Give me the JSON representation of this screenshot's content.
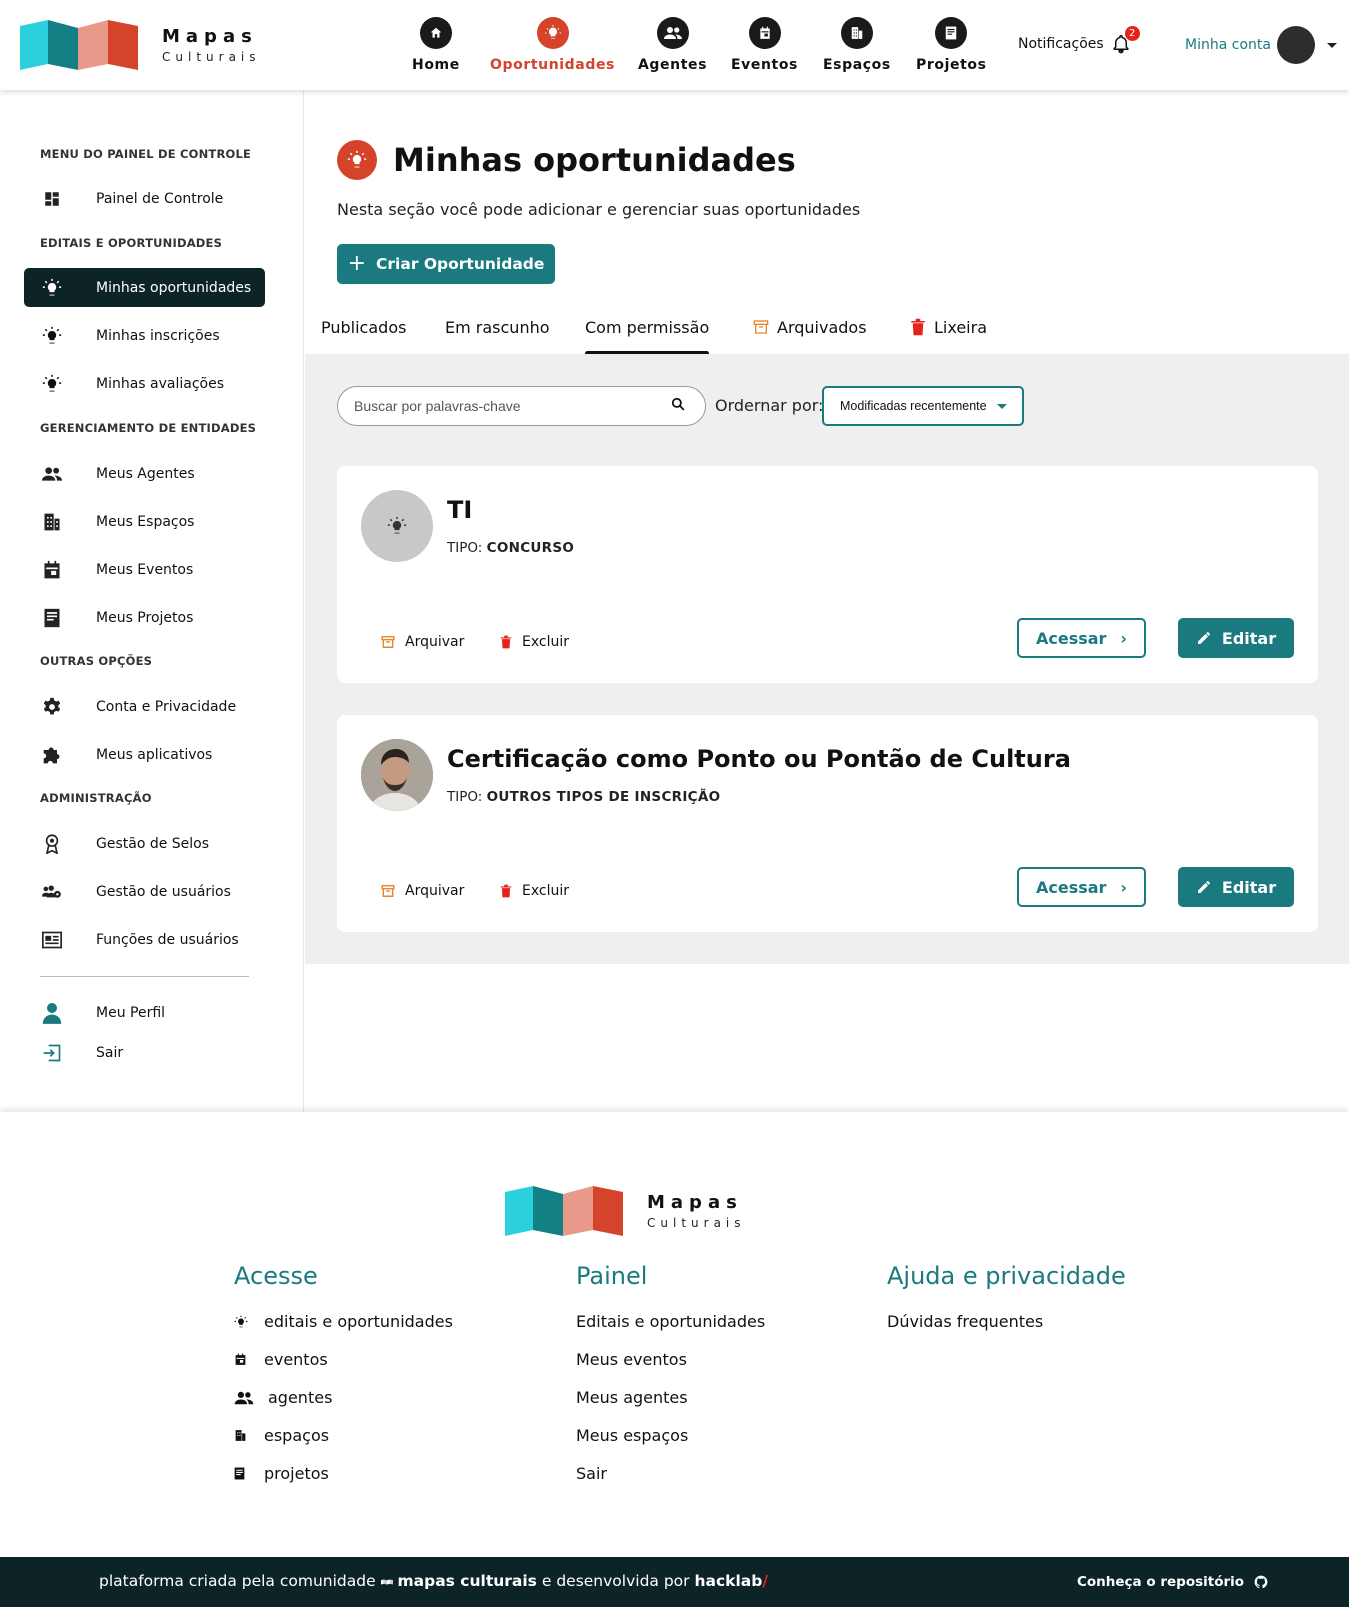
{
  "brand": {
    "name": "Mapas",
    "tagline": "Culturais",
    "colors": {
      "teal": "#1a7a80",
      "orange": "#d4432a",
      "dark": "#0c2426"
    }
  },
  "nav": [
    {
      "label": "Home",
      "icon": "home-icon"
    },
    {
      "label": "Oportunidades",
      "icon": "lightbulb-icon",
      "active": true
    },
    {
      "label": "Agentes",
      "icon": "people-icon"
    },
    {
      "label": "Eventos",
      "icon": "calendar-icon"
    },
    {
      "label": "Espaços",
      "icon": "building-icon"
    },
    {
      "label": "Projetos",
      "icon": "document-icon"
    }
  ],
  "notifications": {
    "label": "Notificações",
    "count": "2"
  },
  "account": {
    "label": "Minha conta"
  },
  "sidebar": {
    "headings": {
      "painel": "MENU DO PAINEL DE CONTROLE",
      "editais": "EDITAIS E OPORTUNIDADES",
      "entidades": "GERENCIAMENTO DE ENTIDADES",
      "outras": "OUTRAS OPÇÕES",
      "admin": "ADMINISTRAÇÃO"
    },
    "items": {
      "painel": "Painel de Controle",
      "oportunidades": "Minhas oportunidades",
      "inscricoes": "Minhas inscrições",
      "avaliacoes": "Minhas avaliações",
      "agentes": "Meus Agentes",
      "espacos": "Meus Espaços",
      "eventos": "Meus Eventos",
      "projetos": "Meus Projetos",
      "conta": "Conta e Privacidade",
      "aplicativos": "Meus aplicativos",
      "selos": "Gestão de Selos",
      "usuarios": "Gestão de usuários",
      "funcoes": "Funções de usuários",
      "perfil": "Meu Perfil",
      "sair": "Sair"
    }
  },
  "page": {
    "title": "Minhas oportunidades",
    "subtitle": "Nesta seção você pode adicionar e gerenciar suas oportunidades",
    "create_label": "Criar Oportunidade"
  },
  "tabs": {
    "publicados": "Publicados",
    "rascunho": "Em rascunho",
    "permissao": "Com permissão",
    "arquivados": "Arquivados",
    "lixeira": "Lixeira",
    "active": "Com permissão"
  },
  "filters": {
    "search_placeholder": "Buscar por palavras-chave",
    "order_label": "Ordernar por:",
    "order_value": "Modificadas recentemente"
  },
  "cards": [
    {
      "title": "TI",
      "type_label": "TIPO:",
      "type_value": "CONCURSO"
    },
    {
      "title": "Certificação como Ponto ou Pontão de Cultura",
      "type_label": "TIPO:",
      "type_value": "OUTROS TIPOS DE INSCRIÇÃO"
    }
  ],
  "card_actions": {
    "archive": "Arquivar",
    "delete": "Excluir",
    "access": "Acessar",
    "edit": "Editar"
  },
  "footer": {
    "acesse": {
      "title": "Acesse",
      "links": [
        "editais e oportunidades",
        "eventos",
        "agentes",
        "espaços",
        "projetos"
      ]
    },
    "painel": {
      "title": "Painel",
      "links": [
        "Editais e oportunidades",
        "Meus eventos",
        "Meus agentes",
        "Meus espaços",
        "Sair"
      ]
    },
    "ajuda": {
      "title": "Ajuda e privacidade",
      "links": [
        "Dúvidas frequentes"
      ]
    }
  },
  "bottom": {
    "prefix": "plataforma criada pela comunidade",
    "community": "mapas culturais",
    "middle": "e desenvolvida por",
    "company": "hacklab",
    "slash": "/",
    "repo": "Conheça o repositório"
  }
}
